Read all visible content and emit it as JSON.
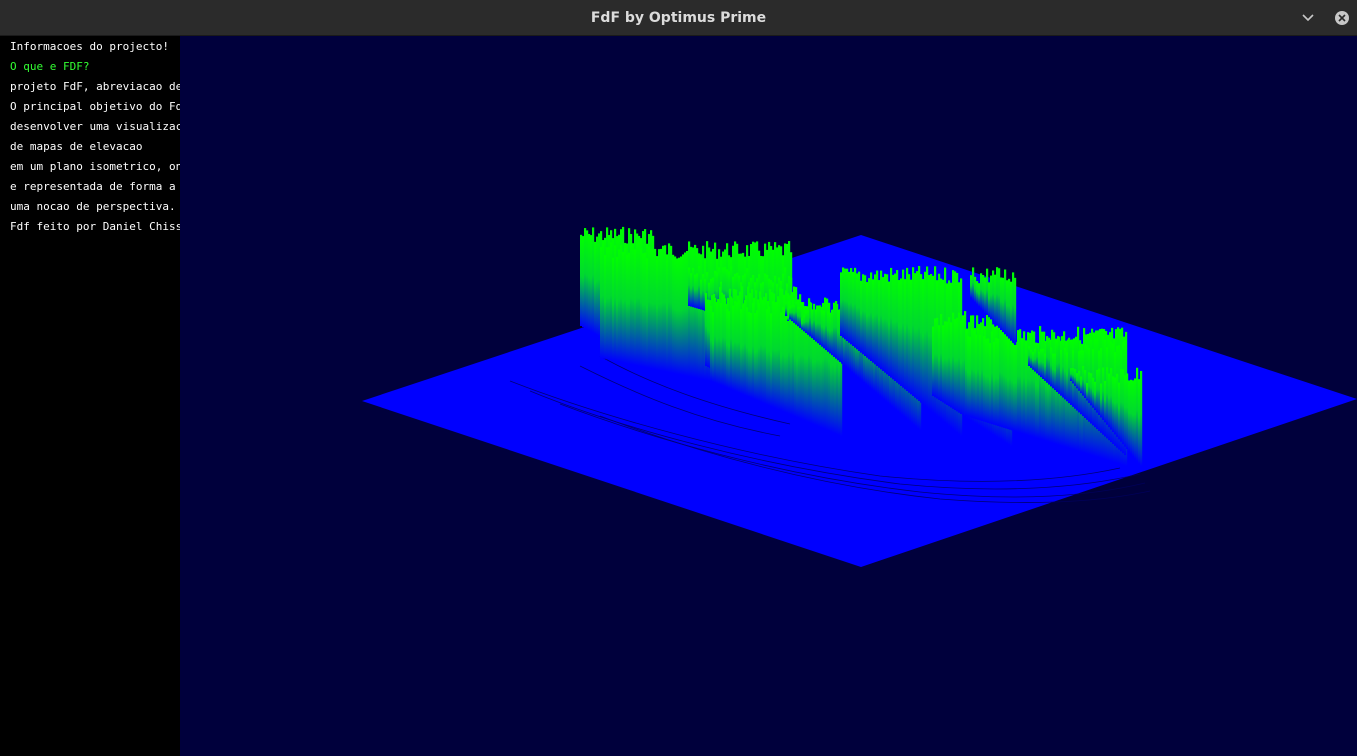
{
  "window": {
    "title": "FdF by Optimus Prime",
    "buttons": [
      {
        "name": "minimize",
        "icon": "chevron-down-icon"
      },
      {
        "name": "close",
        "icon": "close-icon"
      }
    ]
  },
  "sidebar": {
    "lines": [
      {
        "text": "Informacoes do projecto!",
        "color": "#ffffff"
      },
      {
        "text": "O que e FDF?",
        "color": "#33ff33"
      },
      {
        "text": "projeto FdF, abreviacao de <F",
        "color": "#ffffff"
      },
      {
        "text": "O principal objetivo do FdF e",
        "color": "#ffffff"
      },
      {
        "text": "desenvolver uma visualizacao",
        "color": "#ffffff"
      },
      {
        "text": "de mapas de elevacao",
        "color": "#ffffff"
      },
      {
        "text": "em um plano isometrico, onde",
        "color": "#ffffff"
      },
      {
        "text": "e representada de forma a dar",
        "color": "#ffffff"
      },
      {
        "text": "uma nocao de perspectiva.",
        "color": "#ffffff"
      },
      {
        "text": "Fdf feito por Daniel Chissal",
        "color": "#ffffff"
      }
    ]
  },
  "render": {
    "background": "#00003c",
    "ground_color": "#0000ff",
    "peak_color": "#00ff00"
  }
}
